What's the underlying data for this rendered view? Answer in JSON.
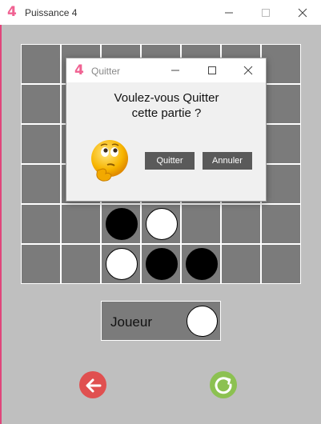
{
  "window": {
    "title": "Puissance 4",
    "app_icon_glyph": "4",
    "controls": [
      "minimize-icon",
      "maximize-icon",
      "close-icon"
    ]
  },
  "board": {
    "columns": 7,
    "rows": 6,
    "pieces": [
      {
        "row": 4,
        "col": 2,
        "color": "black"
      },
      {
        "row": 4,
        "col": 3,
        "color": "white"
      },
      {
        "row": 5,
        "col": 2,
        "color": "white"
      },
      {
        "row": 5,
        "col": 3,
        "color": "black"
      },
      {
        "row": 5,
        "col": 4,
        "color": "black"
      }
    ]
  },
  "player_panel": {
    "label": "Joueur",
    "current_color": "white"
  },
  "footer": {
    "back_button_icon": "back-arrow-icon",
    "restart_button_icon": "restart-icon"
  },
  "dialog": {
    "title": "Quitter",
    "app_icon_glyph": "4",
    "message_line1": "Voulez-vous Quitter",
    "message_line2": "cette partie ?",
    "quit_label": "Quitter",
    "cancel_label": "Annuler",
    "emoji_icon": "thinking-face-icon"
  },
  "colors": {
    "accent": "#f06292",
    "board": "#7b7b7b",
    "background": "#bfbfbf",
    "button_dark": "#5a5a5a",
    "back_red": "#e05050",
    "restart_green": "#8cc151"
  }
}
